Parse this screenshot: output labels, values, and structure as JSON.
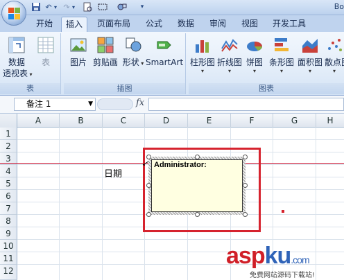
{
  "title_bar": {
    "title": "Bo"
  },
  "tabs": [
    {
      "label": "开始"
    },
    {
      "label": "插入"
    },
    {
      "label": "页面布局"
    },
    {
      "label": "公式"
    },
    {
      "label": "数据"
    },
    {
      "label": "审阅"
    },
    {
      "label": "视图"
    },
    {
      "label": "开发工具"
    }
  ],
  "ribbon": {
    "groups": [
      {
        "label": "表",
        "buttons": [
          {
            "label": "数据"
          },
          {
            "label": "透视表"
          },
          {
            "label": "表"
          }
        ]
      },
      {
        "label": "插图",
        "buttons": [
          {
            "label": "图片"
          },
          {
            "label": "剪贴画"
          },
          {
            "label": "形状"
          },
          {
            "label": "SmartArt"
          }
        ]
      },
      {
        "label": "图表",
        "buttons": [
          {
            "label": "柱形图"
          },
          {
            "label": "折线图"
          },
          {
            "label": "饼图"
          },
          {
            "label": "条形图"
          },
          {
            "label": "面积图"
          },
          {
            "label": "散点图"
          }
        ]
      }
    ]
  },
  "formula_bar": {
    "name_box": "备注 1",
    "fx": "fx",
    "formula": ""
  },
  "columns": [
    "A",
    "B",
    "C",
    "D",
    "E",
    "F",
    "G",
    "H"
  ],
  "rows": [
    "1",
    "2",
    "3",
    "4",
    "5",
    "6",
    "7",
    "8",
    "9",
    "10",
    "11",
    "12"
  ],
  "cells": {
    "C4": "日期"
  },
  "comment": {
    "author": "Administrator:"
  },
  "watermark": {
    "part1": "asp",
    "part2": "ku",
    "suffix": ".com",
    "sub": "免费网站源码下载站!"
  },
  "colors": {
    "highlight": "#d6232e",
    "comment_bg": "#ffffe1",
    "accent": "#2f63b8"
  }
}
